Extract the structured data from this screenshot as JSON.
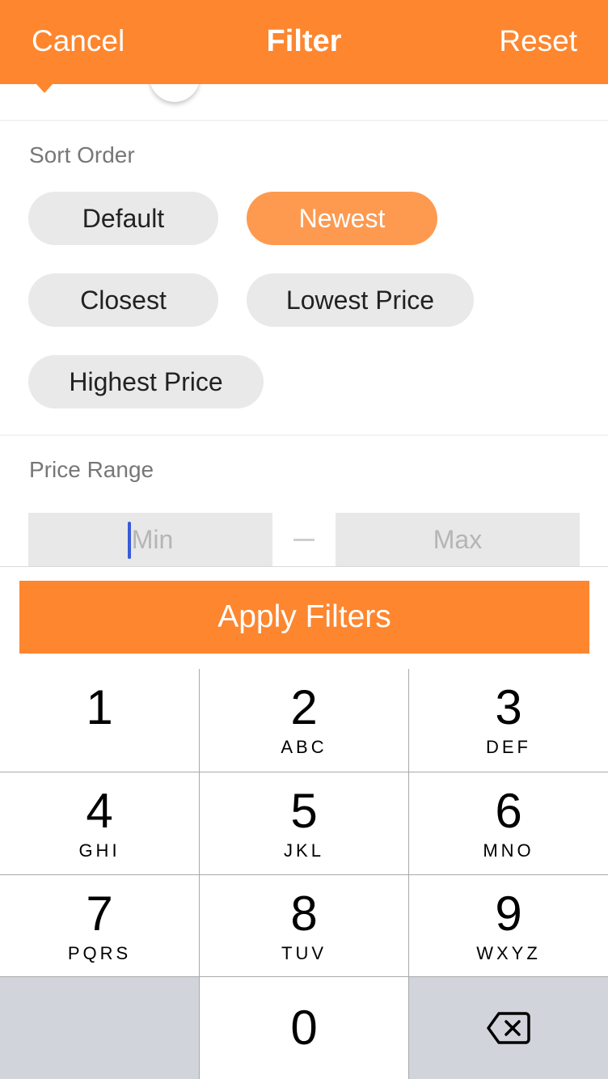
{
  "header": {
    "cancel": "Cancel",
    "title": "Filter",
    "reset": "Reset"
  },
  "colors": {
    "accent": "#fd862f",
    "selected_chip": "#fd9a50",
    "chip": "#e9e9e9",
    "input_bg": "#e8e8e8",
    "caret": "#3a5bd9"
  },
  "sort_order": {
    "label": "Sort Order",
    "selected": "Newest",
    "options": [
      {
        "label": "Default",
        "selected": false
      },
      {
        "label": "Newest",
        "selected": true
      },
      {
        "label": "Closest",
        "selected": false
      },
      {
        "label": "Lowest Price",
        "selected": false
      },
      {
        "label": "Highest Price",
        "selected": false
      }
    ]
  },
  "price_range": {
    "label": "Price Range",
    "min": {
      "value": "",
      "placeholder": "Min",
      "focused": true
    },
    "separator": "–",
    "max": {
      "value": "",
      "placeholder": "Max"
    }
  },
  "apply_button": "Apply Filters",
  "keypad": {
    "keys": [
      {
        "num": "1",
        "letters": ""
      },
      {
        "num": "2",
        "letters": "ABC"
      },
      {
        "num": "3",
        "letters": "DEF"
      },
      {
        "num": "4",
        "letters": "GHI"
      },
      {
        "num": "5",
        "letters": "JKL"
      },
      {
        "num": "6",
        "letters": "MNO"
      },
      {
        "num": "7",
        "letters": "PQRS"
      },
      {
        "num": "8",
        "letters": "TUV"
      },
      {
        "num": "9",
        "letters": "WXYZ"
      },
      {
        "num": "0",
        "letters": ""
      }
    ],
    "backspace_icon": "backspace-icon"
  }
}
